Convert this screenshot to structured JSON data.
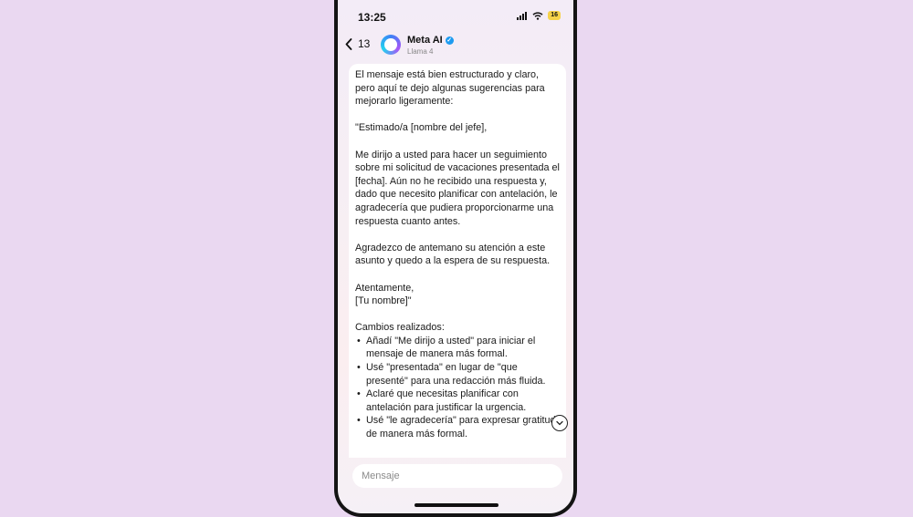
{
  "status_bar": {
    "time": "13:25",
    "battery": "16"
  },
  "header": {
    "back_count": "13",
    "contact_name": "Meta AI",
    "contact_subtitle": "Llama 4"
  },
  "message": {
    "intro": "El mensaje está bien estructurado y claro, pero aquí te dejo algunas sugerencias para mejorarlo ligeramente:",
    "greeting": "\"Estimado/a [nombre del jefe],",
    "body1": "Me dirijo a usted para hacer un seguimiento sobre mi solicitud de vacaciones presentada el [fecha]. Aún no he recibido una respuesta y, dado que necesito planificar con antelación, le agradecería que pudiera proporcionarme una respuesta cuanto antes.",
    "body2": "Agradezco de antemano su atención a este asunto y quedo a la espera de su respuesta.",
    "closing": "Atentamente,",
    "signature": "[Tu nombre]\"",
    "changes_title": "Cambios realizados:",
    "changes": [
      "Añadí \"Me dirijo a usted\" para iniciar el mensaje de manera más formal.",
      "Usé \"presentada\" en lugar de \"que presenté\" para una redacción más fluida.",
      "Aclaré que necesitas planificar con antelación para justificar la urgencia.",
      "Usé \"le agradecería\" para expresar gratitud de manera más formal."
    ]
  },
  "composer": {
    "placeholder": "Mensaje"
  },
  "icons": {
    "signal": "signal-icon",
    "wifi": "wifi-icon",
    "back": "chevron-left-icon",
    "verified": "verified-badge-icon",
    "scroll": "chevron-down-circle-icon"
  },
  "colors": {
    "background": "#ead8f1",
    "verified": "#1d9bf0",
    "battery": "#f6d24a"
  }
}
